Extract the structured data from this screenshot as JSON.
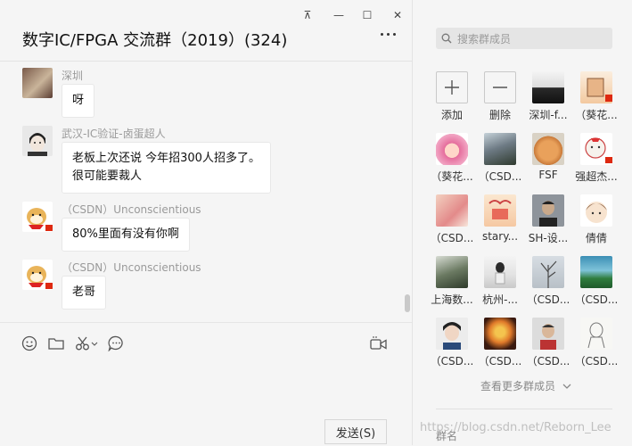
{
  "window": {
    "pin_glyph": "⊼",
    "minimize_glyph": "—",
    "maximize_glyph": "☐",
    "close_glyph": "✕"
  },
  "chat": {
    "title": "数字IC/FPGA  交流群（2019）(324)",
    "messages": [
      {
        "sender": "深圳",
        "text": "呀"
      },
      {
        "sender": "武汉-IC验证-卤蛋超人",
        "lines": [
          "老板上次还说 今年招300人招多了。",
          "很可能要裁人"
        ]
      },
      {
        "sender": "（CSDN）Unconscientious",
        "text": "80%里面有没有你啊"
      },
      {
        "sender": "（CSDN）Unconscientious",
        "text": "老哥"
      }
    ]
  },
  "toolbar": {
    "icons": [
      "emoji-icon",
      "folder-icon",
      "scissors-icon",
      "chat-history-icon",
      "video-call-icon"
    ],
    "send_label": "发送(S)"
  },
  "members": {
    "search_placeholder": "搜索群成员",
    "add_label": "添加",
    "remove_label": "删除",
    "list": [
      "深圳-f...",
      "（葵花...",
      "（葵花...",
      "（CSD...",
      "FSF",
      "强超杰...",
      "（CSD...",
      "stary...",
      "SH-设...",
      "倩倩",
      "上海数...",
      "杭州-...",
      "（CSD...",
      "（CSD...",
      "（CSD...",
      "（CSD...",
      "（CSD...",
      "（CSD..."
    ],
    "view_more": "查看更多群成员",
    "group_name_label": "群名"
  },
  "watermark": "https://blog.csdn.net/Reborn_Lee",
  "colors": {
    "background": "#f5f5f5",
    "bubble": "#ffffff",
    "muted_text": "#9a9a9a"
  }
}
